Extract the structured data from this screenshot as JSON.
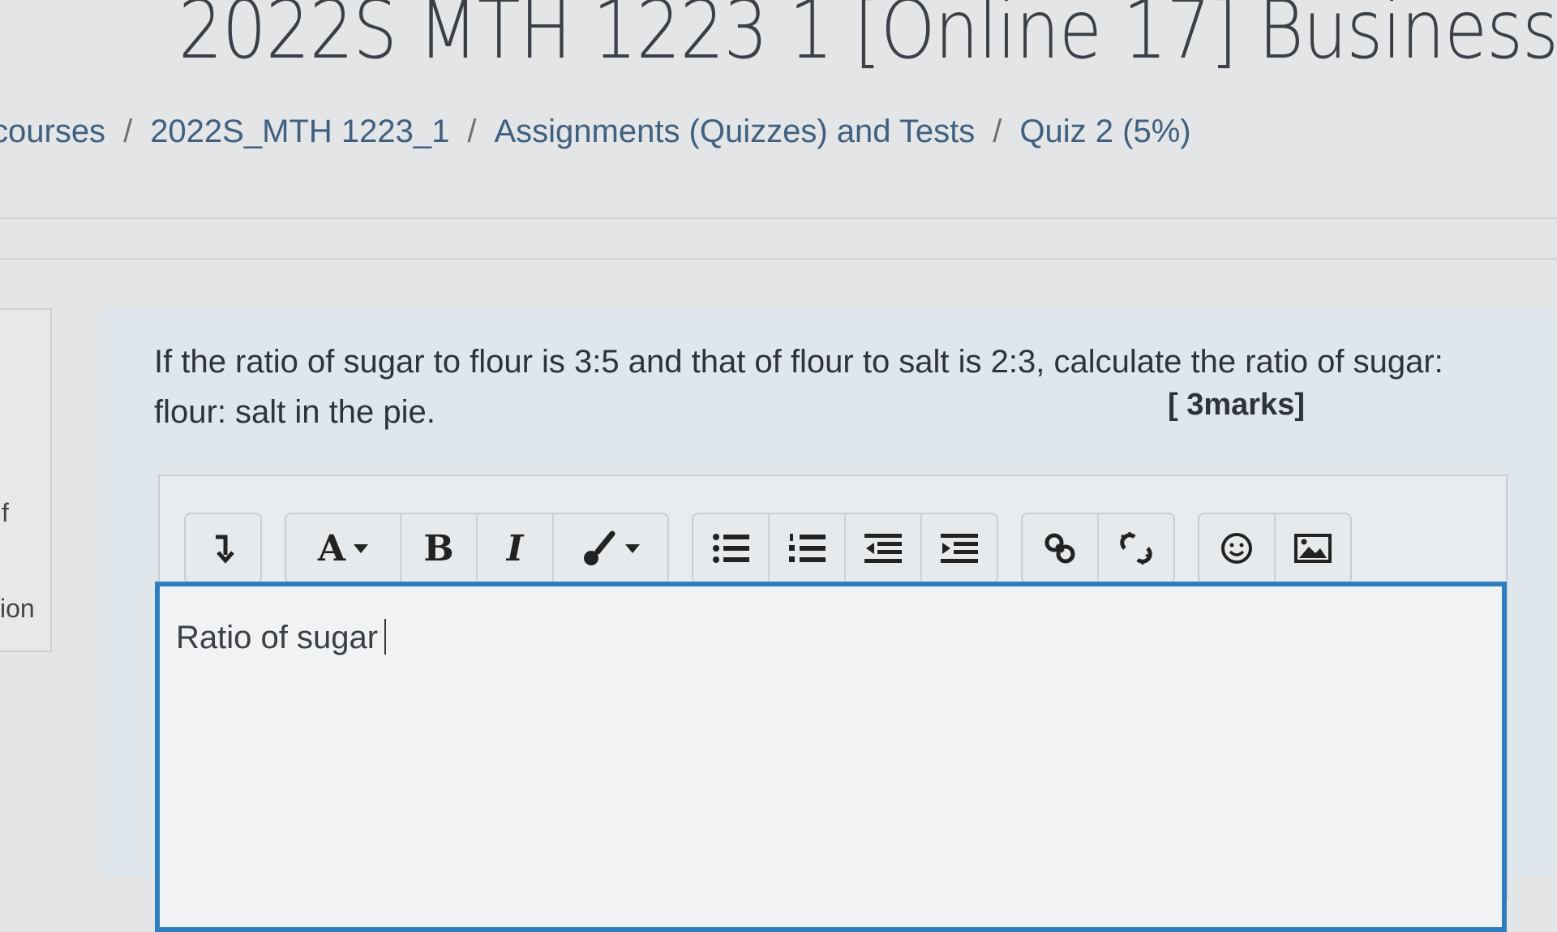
{
  "page": {
    "title": "2022S MTH 1223 1 [Online 17] Business"
  },
  "breadcrumb": {
    "items": [
      "courses",
      "2022S_MTH 1223_1",
      "Assignments (Quizzes) and Tests",
      "Quiz 2 (5%)"
    ],
    "separator": "/"
  },
  "left_panel": {
    "fragment_1": "f",
    "fragment_2": "ion"
  },
  "question": {
    "text": "If the ratio of sugar to flour is 3:5 and that of flour to salt is 2:3, calculate the ratio of sugar: flour: salt in the pie.",
    "marks": "[ 3marks]"
  },
  "editor": {
    "toolbar": {
      "groups": [
        [
          "expand-toolbar"
        ],
        [
          "font-style",
          "bold",
          "italic",
          "text-color"
        ],
        [
          "unordered-list",
          "ordered-list",
          "outdent",
          "indent"
        ],
        [
          "link",
          "unlink"
        ],
        [
          "emoji",
          "image"
        ]
      ],
      "font_label": "A",
      "bold_label": "B",
      "italic_label": "I"
    },
    "content": "Ratio of sugar",
    "accent_color": "#2d7dbf"
  }
}
